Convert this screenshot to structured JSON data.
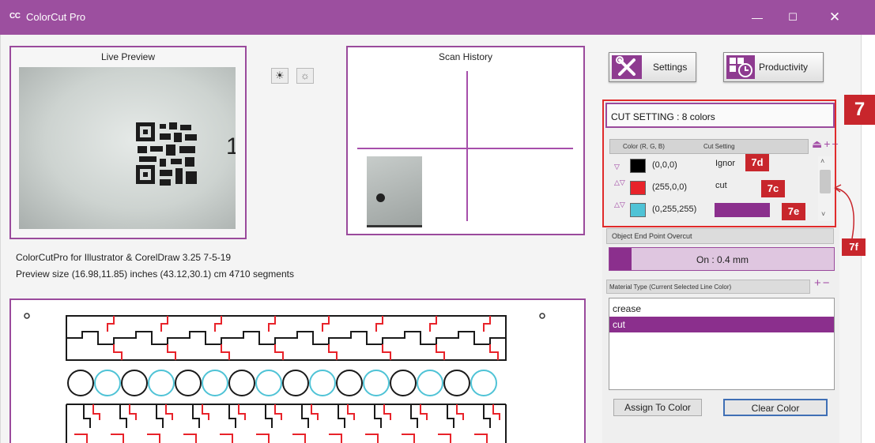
{
  "window": {
    "icon_text": "CC",
    "title": "ColorCut Pro",
    "minimize_glyph": "—",
    "maximize_glyph": "☐",
    "close_glyph": "✕"
  },
  "live_preview": {
    "title": "Live Preview",
    "cam_digit": "1",
    "light_on_glyph": "☀",
    "light_off_glyph": "☼"
  },
  "scan_history": {
    "title": "Scan History"
  },
  "info": {
    "version_line": "ColorCutPro for Illustrator & CorelDraw 3.25 7-5-19",
    "size_line": "Preview size (16.98,11.85) inches  (43.12,30.1) cm   4710 segments"
  },
  "toolbar": {
    "settings_label": "Settings",
    "productivity_label": "Productivity"
  },
  "cut_setting": {
    "title": "CUT SETTING : 8 colors",
    "col_color": "Color (R, G, B)",
    "col_setting": "Cut Setting",
    "header_buttons": "⏏+−",
    "rows": [
      {
        "rgb": "(0,0,0)",
        "swatch": "#000000",
        "setting": "Ignor",
        "arrows": "▽"
      },
      {
        "rgb": "(255,0,0)",
        "swatch": "#e8232a",
        "setting": "cut",
        "arrows": "△▽"
      },
      {
        "rgb": "(0,255,255)",
        "swatch": "#4fc3d6",
        "setting": "",
        "arrows": "△▽"
      }
    ],
    "scroll_up": "˄",
    "scroll_down": "˅"
  },
  "callouts": {
    "main": "7",
    "c7d": "7d",
    "c7c": "7c",
    "c7e": "7e",
    "c7f": "7f"
  },
  "overcut": {
    "header": "Object End Point Overcut",
    "value": "On : 0.4 mm"
  },
  "material": {
    "header": "Material Type (Current Selected Line Color)",
    "header_buttons": "+−",
    "items": [
      "crease",
      "cut"
    ],
    "selected_index": 1
  },
  "actions": {
    "assign": "Assign To Color",
    "clear": "Clear Color"
  },
  "colors": {
    "brand_purple": "#9c4f9f",
    "accent_purple": "#8b2f8d",
    "callout_red": "#c8262c",
    "cut_red": "#e8232a",
    "crease_cyan": "#4fc3d6"
  }
}
